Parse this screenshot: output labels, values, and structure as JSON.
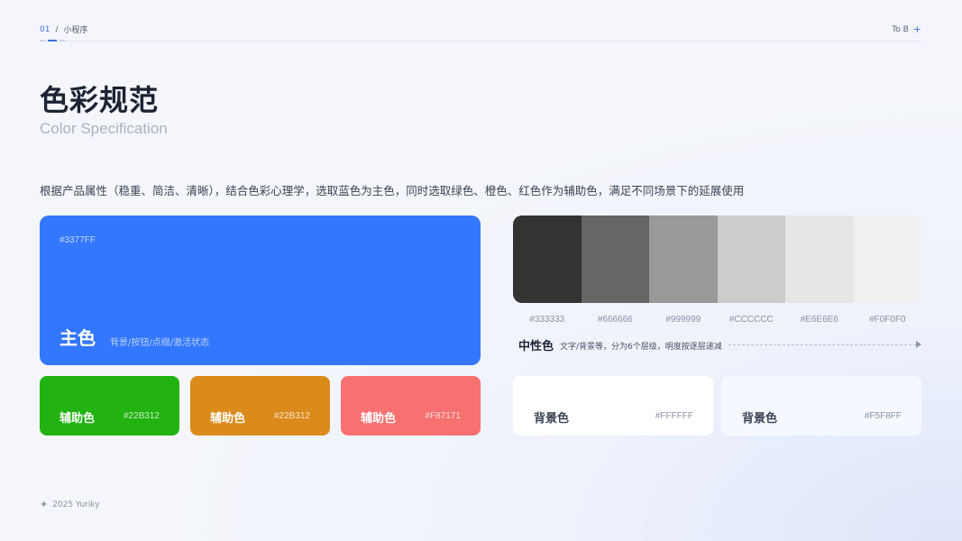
{
  "header": {
    "page_num": "01",
    "separator": "/",
    "section": "小程序",
    "tag": "To B",
    "tag_icon": "plus-icon"
  },
  "title": "色彩规范",
  "subtitle": "Color Specification",
  "description": "根据产品属性（稳重、简洁、清晰），结合色彩心理学，选取蓝色为主色，同时选取绿色、橙色、红色作为辅助色，满足不同场景下的延展使用",
  "primary": {
    "hex": "#3377FF",
    "name": "主色",
    "note": "背景/按钮/点缀/激活状态",
    "color": "#3377FF"
  },
  "auxiliary": [
    {
      "name": "辅助色",
      "hex": "#22B312",
      "color": "#22B312"
    },
    {
      "name": "辅助色",
      "hex": "#22B312",
      "color": "#DB8B1B"
    },
    {
      "name": "辅助色",
      "hex": "#F87171",
      "color": "#F87171"
    }
  ],
  "neutral": {
    "title": "中性色",
    "note": "文字/背景等，分为6个层级，明度按逐层递减",
    "swatches": [
      {
        "hex": "#333333",
        "color": "#333333"
      },
      {
        "hex": "#666666",
        "color": "#666666"
      },
      {
        "hex": "#999999",
        "color": "#999999"
      },
      {
        "hex": "#CCCCCC",
        "color": "#CCCCCC"
      },
      {
        "hex": "#E6E6E6",
        "color": "#E6E6E6"
      },
      {
        "hex": "#F0F0F0",
        "color": "#F0F0F0"
      }
    ]
  },
  "backgrounds": [
    {
      "name": "背景色",
      "hex": "#FFFFFF",
      "color": "#FFFFFF"
    },
    {
      "name": "背景色",
      "hex": "#F5F8FF",
      "color": "#F5F8FF"
    }
  ],
  "footer": {
    "icon": "sparkle-icon",
    "text": "2025  Yuriky"
  }
}
